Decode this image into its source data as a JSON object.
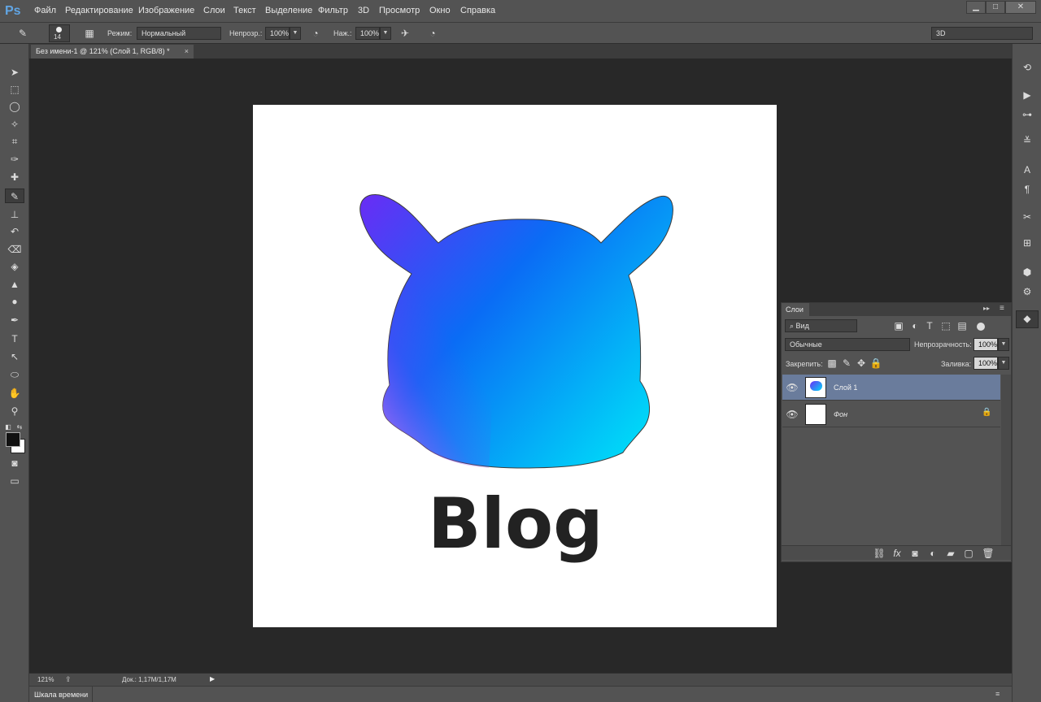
{
  "app": {
    "logo": "Ps",
    "window_controls": [
      "minimize-icon",
      "maximize-icon",
      "close-icon"
    ]
  },
  "menu": [
    "Файл",
    "Редактирование",
    "Изображение",
    "Слои",
    "Текст",
    "Выделение",
    "Фильтр",
    "3D",
    "Просмотр",
    "Окно",
    "Справка"
  ],
  "options": {
    "brush_size": "14",
    "mode_label": "Режим:",
    "mode_value": "Нормальный",
    "opacity_label": "Непрозр.:",
    "opacity_value": "100%",
    "flow_label": "Наж.:",
    "flow_value": "100%",
    "workspace": "3D"
  },
  "document": {
    "tab_title": "Без имени-1 @ 121% (Слой 1, RGB/8) *",
    "canvas_text": "Blog"
  },
  "layers_panel": {
    "title": "Слои",
    "filter_label": "Вид",
    "blend_mode": "Обычные",
    "opacity_label": "Непрозрачность:",
    "opacity_value": "100%",
    "lock_label": "Закрепить:",
    "fill_label": "Заливка:",
    "fill_value": "100%",
    "layers": [
      {
        "name": "Слой 1",
        "selected": true
      },
      {
        "name": "Фон",
        "selected": false,
        "locked": true
      }
    ]
  },
  "status": {
    "zoom": "121%",
    "doc_info": "Док.: 1,17М/1,17М"
  },
  "timeline": {
    "label": "Шкала времени"
  },
  "colors": {
    "accent": "#61a5e4",
    "selected_layer": "#6a7c9c",
    "gradient_start": "#6a2cf5",
    "gradient_mid": "#0a6cf5",
    "gradient_end": "#00d8f8"
  }
}
